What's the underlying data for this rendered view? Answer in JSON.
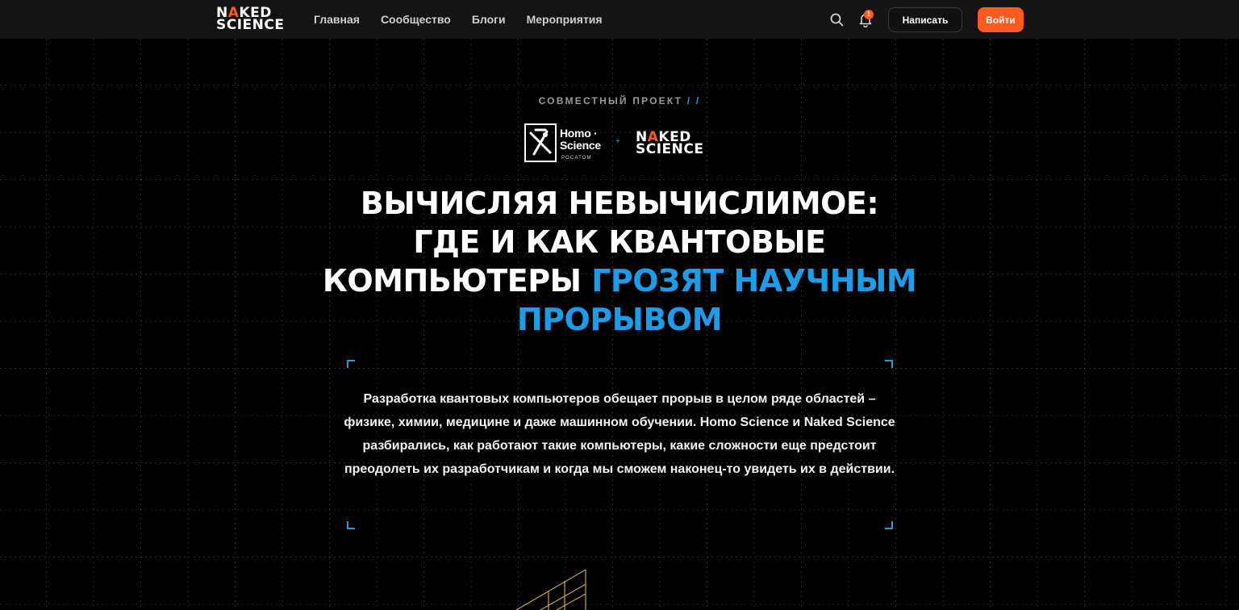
{
  "header": {
    "brand": {
      "line1_a": "N",
      "line1_b": "A",
      "line1_c": "KED",
      "line2": "SCIENCE"
    },
    "nav": [
      "Главная",
      "Сообщество",
      "Блоги",
      "Мероприятия"
    ],
    "notifications_count": "1",
    "write_label": "Написать",
    "login_label": "Войти",
    "icons": [
      "search-icon",
      "bell-icon"
    ],
    "accent_color": "#ff5a1f"
  },
  "hero": {
    "kicker": "СОВМЕСТНЫЙ ПРОЕКТ",
    "kicker_slashes": "/ /",
    "partner1": {
      "line1": "Homo ·",
      "line2": "Science",
      "sub": "РОСАТОМ"
    },
    "partner_join": "+",
    "partner2": {
      "line1_a": "N",
      "line1_b": "A",
      "line1_c": "KED",
      "line2": "SCIENCE"
    },
    "title_white_1": "Вычисляя невычислимое:",
    "title_white_2": "где и как квантовые",
    "title_white_3": "компьютеры",
    "title_blue_1": "грозят научным",
    "title_blue_2": "прорывом",
    "title_accent_color": "#1f9be8",
    "lead": "Разработка квантовых компьютеров обещает прорыв в целом ряде областей – физике, химии, медицине и даже машинном обучении. Homo Science и Naked Science разбирались, как работают такие компьютеры, какие сложности еще предстоит преодолеть их разработчикам и когда мы сможем наконец-то увидеть их в действии."
  }
}
